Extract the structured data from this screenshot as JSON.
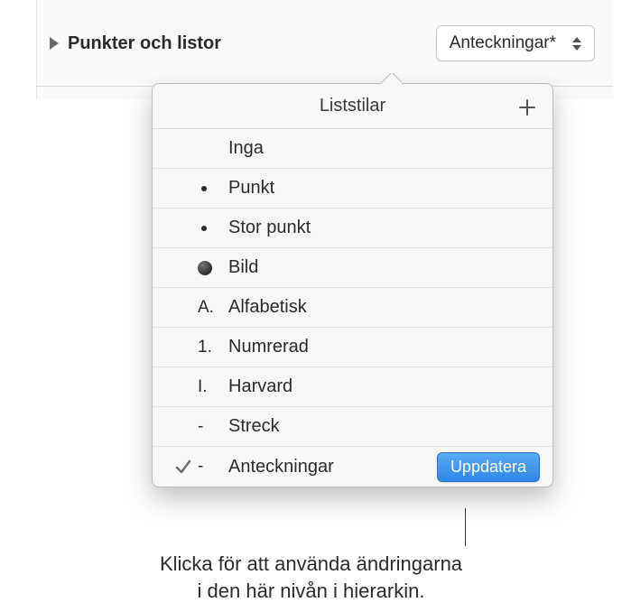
{
  "header": {
    "label": "Punkter och listor",
    "select_value": "Anteckningar*"
  },
  "popover": {
    "title": "Liststilar",
    "items": [
      {
        "marker": "",
        "marker_type": "none",
        "label": "Inga",
        "checked": false,
        "has_update": false
      },
      {
        "marker": "",
        "marker_type": "small",
        "label": "Punkt",
        "checked": false,
        "has_update": false
      },
      {
        "marker": "",
        "marker_type": "small",
        "label": "Stor punkt",
        "checked": false,
        "has_update": false
      },
      {
        "marker": "",
        "marker_type": "large",
        "label": "Bild",
        "checked": false,
        "has_update": false
      },
      {
        "marker": "A.",
        "marker_type": "text",
        "label": "Alfabetisk",
        "checked": false,
        "has_update": false
      },
      {
        "marker": "1.",
        "marker_type": "text",
        "label": "Numrerad",
        "checked": false,
        "has_update": false
      },
      {
        "marker": "I.",
        "marker_type": "text",
        "label": "Harvard",
        "checked": false,
        "has_update": false
      },
      {
        "marker": "-",
        "marker_type": "text",
        "label": "Streck",
        "checked": false,
        "has_update": false
      },
      {
        "marker": "-",
        "marker_type": "text",
        "label": "Anteckningar",
        "checked": true,
        "has_update": true
      }
    ],
    "update_label": "Uppdatera"
  },
  "callout": {
    "line1": "Klicka för att använda ändringarna",
    "line2": "i den här nivån i hierarkin."
  }
}
